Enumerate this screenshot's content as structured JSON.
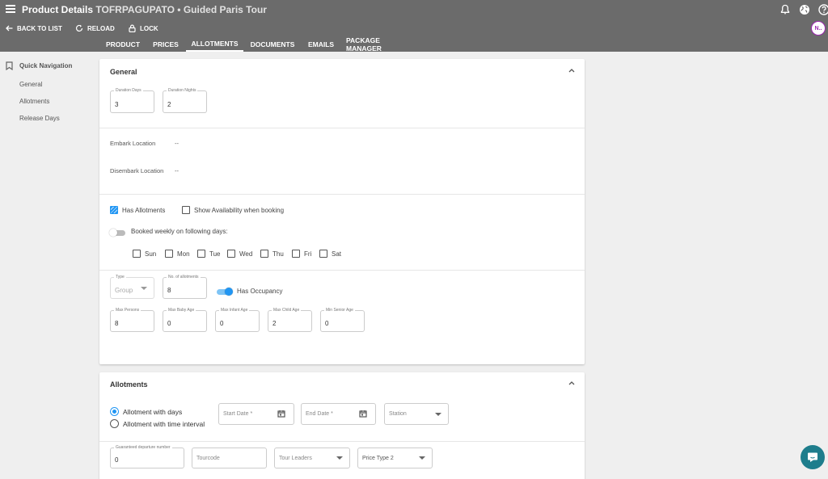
{
  "header": {
    "title": "Product Details",
    "code": "TOFRPAGUPATO",
    "separator": "•",
    "subtitle": "Guided Paris Tour",
    "back_label": "BACK TO LIST",
    "reload_label": "RELOAD",
    "lock_label": "LOCK",
    "avatar_initials": "N..",
    "icons": [
      "menu-icon",
      "bell-icon",
      "globe-icon",
      "help-icon"
    ]
  },
  "tabs": [
    {
      "label": "PRODUCT"
    },
    {
      "label": "PRICES"
    },
    {
      "label": "ALLOTMENTS",
      "active": true
    },
    {
      "label": "DOCUMENTS"
    },
    {
      "label": "EMAILS"
    },
    {
      "label": "PACKAGE MANAGER"
    }
  ],
  "sidebar": {
    "title": "Quick Navigation",
    "items": [
      {
        "label": "General"
      },
      {
        "label": "Allotments"
      },
      {
        "label": "Release Days"
      }
    ]
  },
  "general": {
    "title": "General",
    "duration_days": {
      "label": "Duration Days",
      "value": "3"
    },
    "duration_nights": {
      "label": "Duration Nights",
      "value": "2"
    },
    "embark": {
      "label": "Embark Location",
      "value": "--"
    },
    "disembark": {
      "label": "Disembark Location",
      "value": "--"
    },
    "has_allotments": {
      "label": "Has Allotments",
      "checked": true
    },
    "show_availability": {
      "label": "Show Availability when booking",
      "checked": false
    },
    "booked_weekly": {
      "label": "Booked weekly on following days:",
      "on": false
    },
    "days": [
      {
        "label": "Sun"
      },
      {
        "label": "Mon"
      },
      {
        "label": "Tue"
      },
      {
        "label": "Wed"
      },
      {
        "label": "Thu"
      },
      {
        "label": "Fri"
      },
      {
        "label": "Sat"
      }
    ],
    "type": {
      "label": "Type",
      "value": "Group"
    },
    "num_allotments": {
      "label": "No. of allotments",
      "value": "8"
    },
    "has_occupancy": {
      "label": "Has Occupancy",
      "on": true
    },
    "max_persons": {
      "label": "Max Persons",
      "value": "8"
    },
    "max_baby_age": {
      "label": "Max Baby Age",
      "value": "0"
    },
    "max_infant_age": {
      "label": "Max Infant Age",
      "value": "0"
    },
    "max_child_age": {
      "label": "Max Child Age",
      "value": "2"
    },
    "min_senior_age": {
      "label": "Min Senior Age",
      "value": "0"
    }
  },
  "allotments": {
    "title": "Allotments",
    "radio_days": "Allotment with days",
    "radio_interval": "Allotment with time interval",
    "start_date_placeholder": "Start Date *",
    "end_date_placeholder": "End Date *",
    "station_placeholder": "Station",
    "guaranteed": {
      "label": "Guaranteed departure number",
      "value": "0"
    },
    "tourcode_placeholder": "Tourcode",
    "tour_leaders_placeholder": "Tour Leaders",
    "price_type_value": "Price Type 2"
  },
  "colors": {
    "appbar": "#6b6b6b",
    "accent": "#2196f3",
    "chat": "#1e7d8c"
  }
}
